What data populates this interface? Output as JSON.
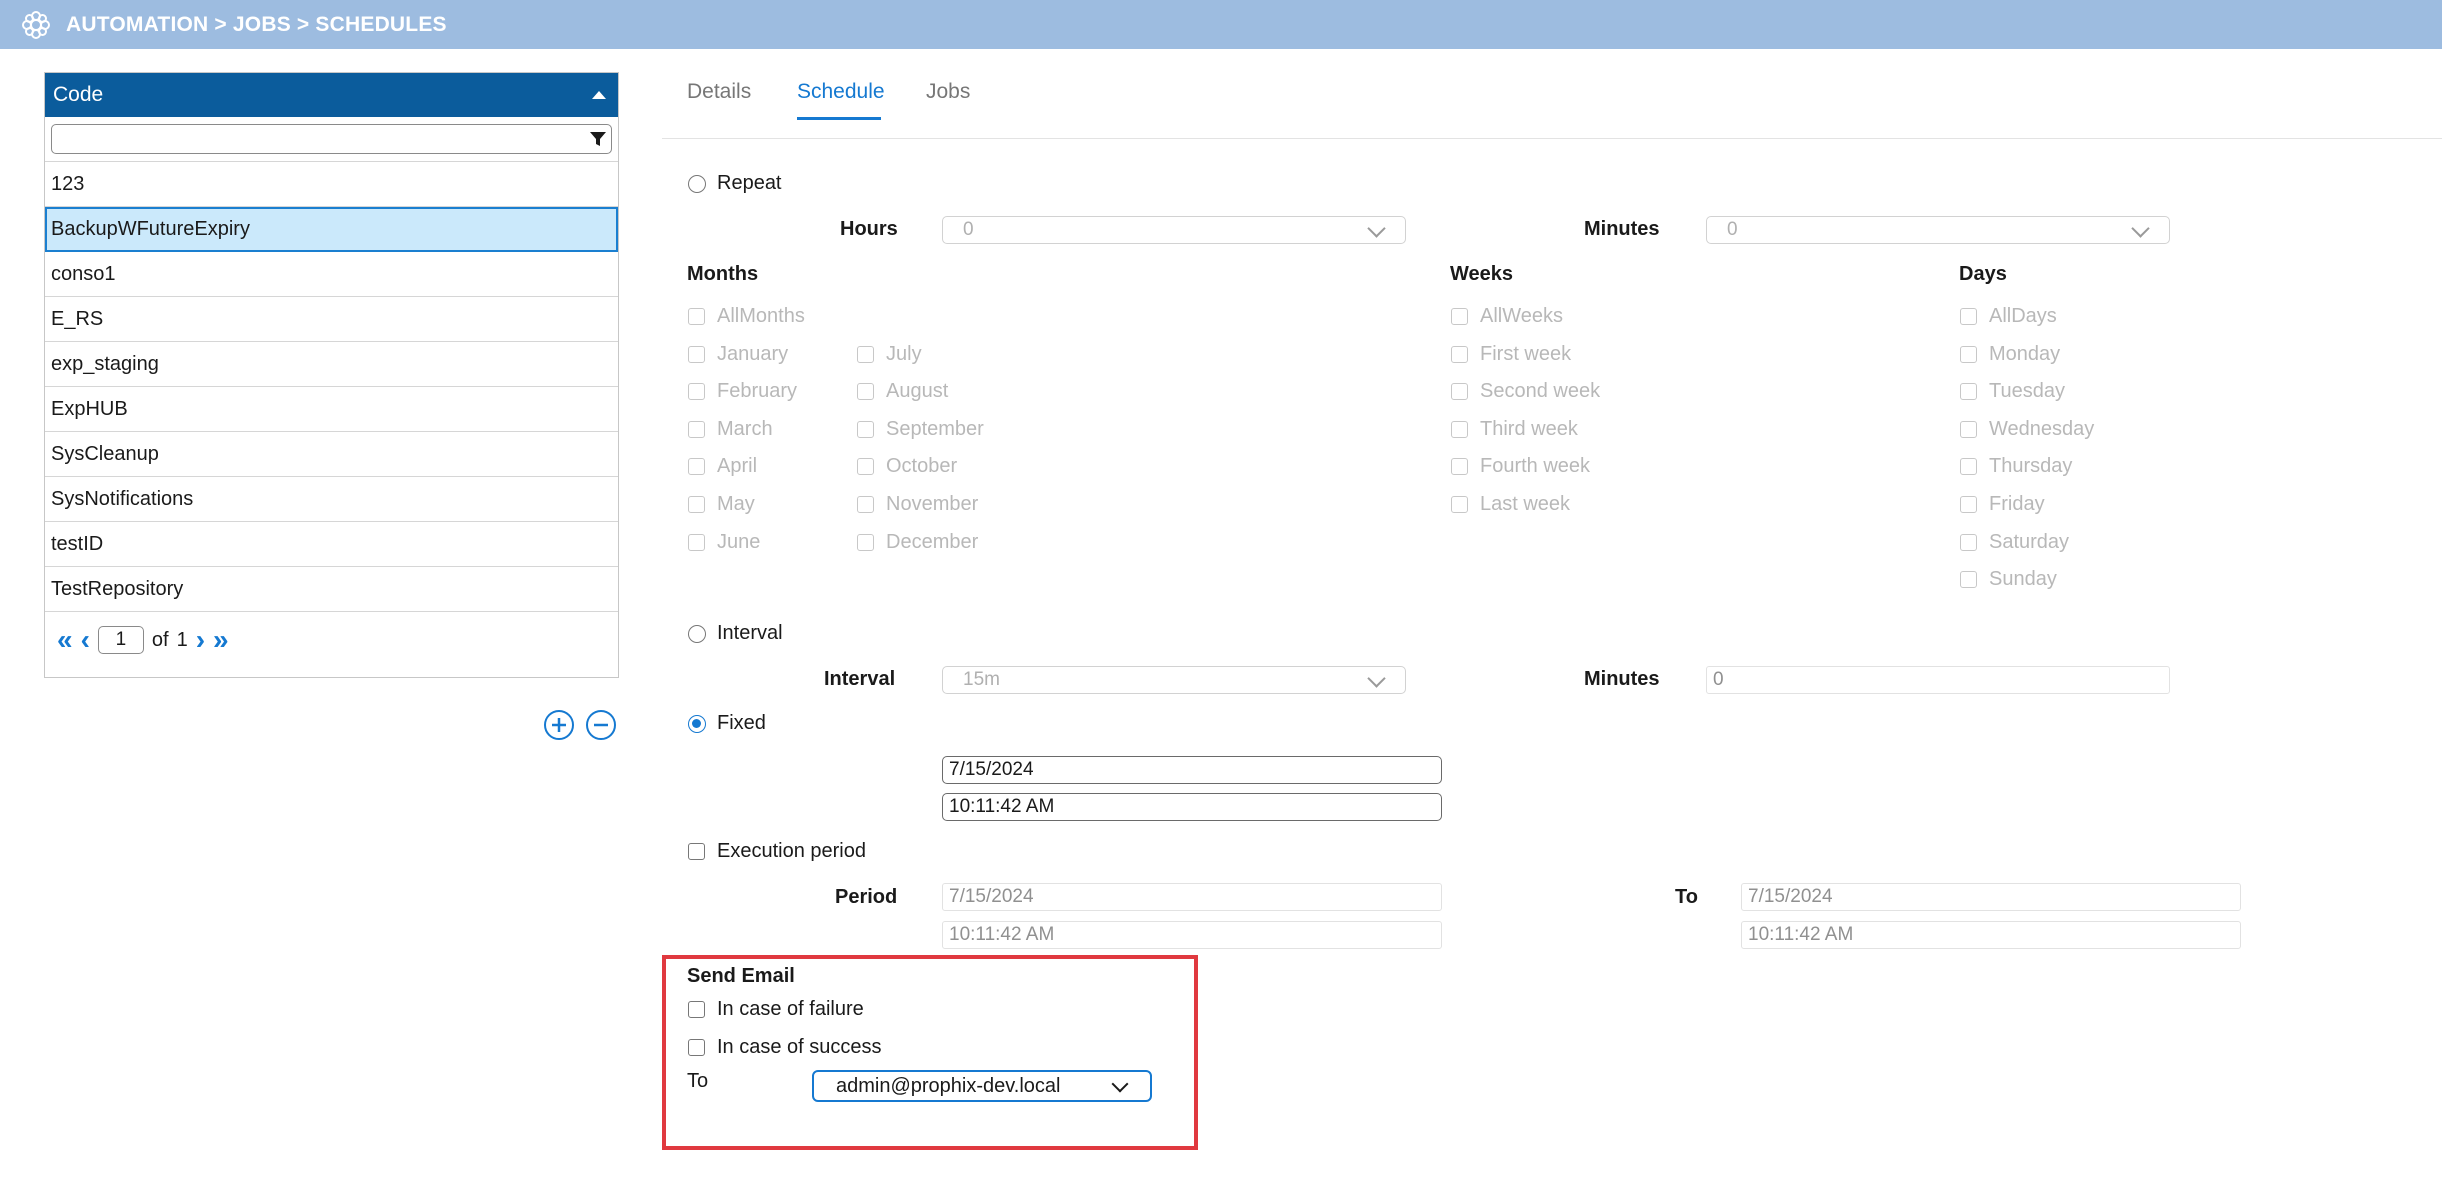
{
  "header": {
    "breadcrumb": "AUTOMATION > JOBS > SCHEDULES",
    "logo_icon": "gear-flower-icon"
  },
  "list": {
    "column": "Code",
    "filter_value": "",
    "items": [
      "123",
      "BackupWFutureExpiry",
      "conso1",
      "E_RS",
      "exp_staging",
      "ExpHUB",
      "SysCleanup",
      "SysNotifications",
      "testID",
      "TestRepository"
    ],
    "selected": "BackupWFutureExpiry",
    "pager": {
      "page": "1",
      "of": "of",
      "total": "1"
    }
  },
  "tabs": [
    {
      "label": "Details"
    },
    {
      "label": "Schedule"
    },
    {
      "label": "Jobs"
    }
  ],
  "active_tab": "Schedule",
  "repeat": {
    "label": "Repeat",
    "hours_label": "Hours",
    "hours_value": "0",
    "minutes_label": "Minutes",
    "minutes_value": "0",
    "months_title": "Months",
    "months": [
      "AllMonths",
      "January",
      "February",
      "March",
      "April",
      "May",
      "June",
      "July",
      "August",
      "September",
      "October",
      "November",
      "December"
    ],
    "weeks_title": "Weeks",
    "weeks": [
      "AllWeeks",
      "First week",
      "Second week",
      "Third week",
      "Fourth week",
      "Last week"
    ],
    "days_title": "Days",
    "days": [
      "AllDays",
      "Monday",
      "Tuesday",
      "Wednesday",
      "Thursday",
      "Friday",
      "Saturday",
      "Sunday"
    ]
  },
  "interval": {
    "label": "Interval",
    "interval_label": "Interval",
    "interval_value": "15m",
    "minutes_label": "Minutes",
    "minutes_value": "0"
  },
  "fixed": {
    "label": "Fixed",
    "date": "7/15/2024",
    "time": "10:11:42 AM",
    "selected": true
  },
  "execution_period": {
    "label": "Execution period",
    "period_label": "Period",
    "from_date": "7/15/2024",
    "from_time": "10:11:42 AM",
    "to_label": "To",
    "to_date": "7/15/2024",
    "to_time": "10:11:42 AM"
  },
  "send_email": {
    "title": "Send Email",
    "on_failure": "In case of failure",
    "on_success": "In case of success",
    "to_label": "To",
    "to_value": "admin@prophix-dev.local"
  },
  "colors": {
    "header": "#9dbce0",
    "list_header": "#0b5c9c",
    "accent": "#1579d1",
    "highlight_box": "#e0393f",
    "selected_row": "#cbe9fb"
  }
}
